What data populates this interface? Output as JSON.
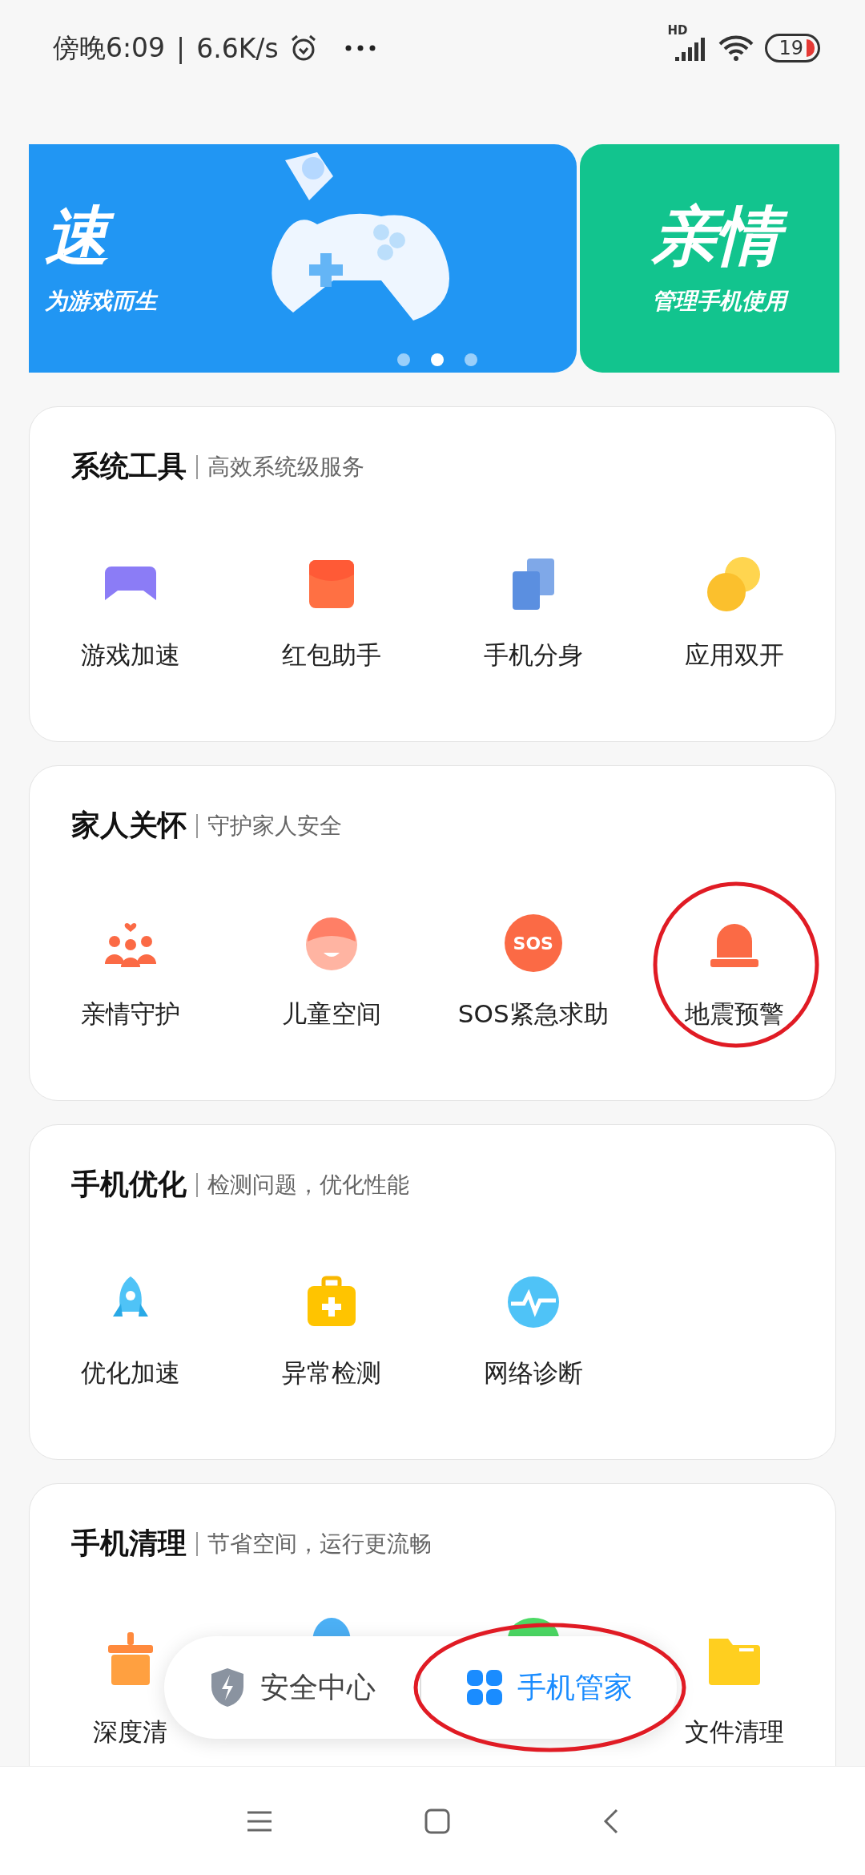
{
  "status_bar": {
    "time": "傍晚6:09",
    "separator": "|",
    "speed": "6.6K/s",
    "signal_label": "HD",
    "battery": "19"
  },
  "banners": [
    {
      "title": "速",
      "subtitle": "为游戏而生",
      "color": "#2196f3"
    },
    {
      "title": "亲情",
      "subtitle": "管理手机使用",
      "color": "#12c48e"
    }
  ],
  "banner_dots": [
    {
      "selected": false
    },
    {
      "selected": true
    },
    {
      "selected": false
    }
  ],
  "sections": [
    {
      "title": "系统工具",
      "subtitle": "高效系统级服务",
      "items": [
        {
          "label": "游戏加速",
          "kind": "game",
          "circled": false
        },
        {
          "label": "红包助手",
          "kind": "redpacket",
          "circled": false
        },
        {
          "label": "手机分身",
          "kind": "clone",
          "circled": false
        },
        {
          "label": "应用双开",
          "kind": "dual",
          "circled": false
        }
      ]
    },
    {
      "title": "家人关怀",
      "subtitle": "守护家人安全",
      "items": [
        {
          "label": "亲情守护",
          "kind": "family",
          "circled": false
        },
        {
          "label": "儿童空间",
          "kind": "child",
          "circled": false
        },
        {
          "label": "SOS紧急求助",
          "kind": "sos",
          "badge": "SOS",
          "circled": false
        },
        {
          "label": "地震预警",
          "kind": "alarm",
          "circled": true
        }
      ]
    },
    {
      "title": "手机优化",
      "subtitle": "检测问题，优化性能",
      "items": [
        {
          "label": "优化加速",
          "kind": "rocket",
          "circled": false
        },
        {
          "label": "异常检测",
          "kind": "kit",
          "circled": false
        },
        {
          "label": "网络诊断",
          "kind": "pulse",
          "circled": false
        }
      ]
    },
    {
      "title": "手机清理",
      "subtitle": "节省空间，运行更流畅",
      "items": [
        {
          "label": "深度清",
          "kind": "broom",
          "circled": false
        },
        {
          "kind": "qq"
        },
        {
          "kind": "wechat"
        },
        {
          "label": "文件清理",
          "kind": "folder",
          "circled": false
        }
      ]
    }
  ],
  "bottom_tabs": [
    {
      "label": "安全中心",
      "kind": "shield",
      "selected": false,
      "circled": false
    },
    {
      "label": "手机管家",
      "kind": "grid",
      "selected": true,
      "circled": true
    }
  ]
}
